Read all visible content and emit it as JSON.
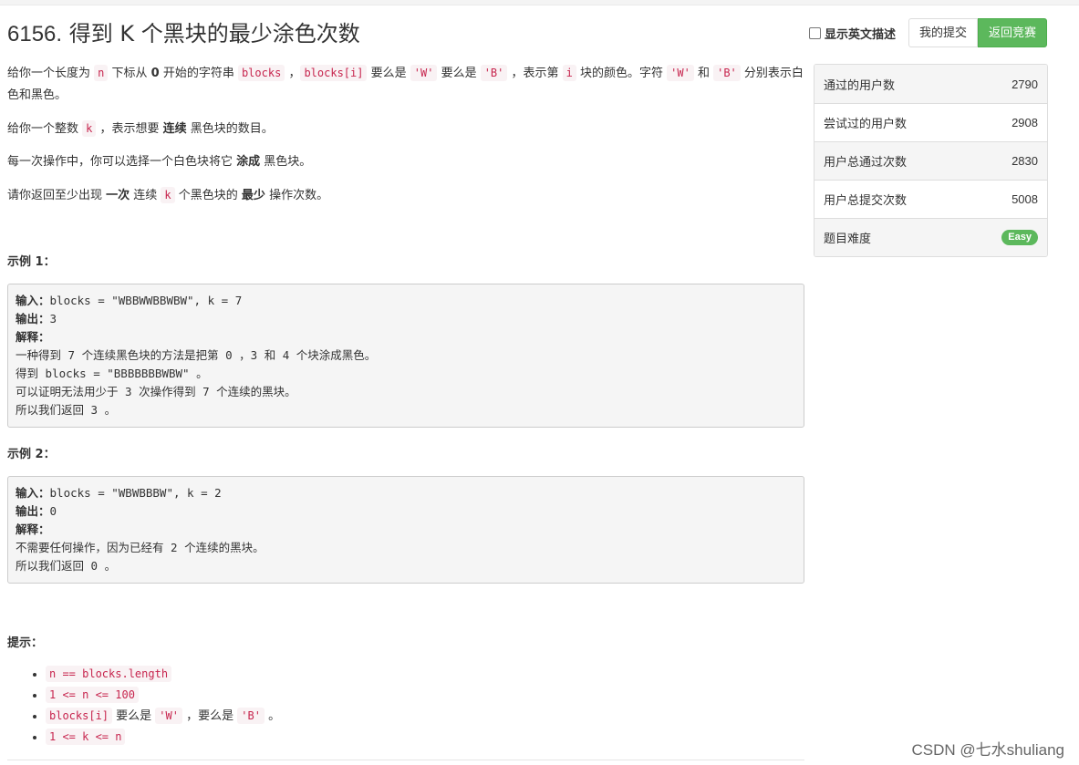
{
  "problem": {
    "number": "6156.",
    "title_text": "得到 K 个黑块的最少涂色次数"
  },
  "toolbar": {
    "english_toggle_label": "显示英文描述",
    "my_submissions_label": "我的提交",
    "back_to_contest_label": "返回竞赛"
  },
  "description": {
    "p1": {
      "t1": "给你一个长度为 ",
      "c1": "n",
      "t2": " 下标从 ",
      "b1": "0",
      "t3": " 开始的字符串 ",
      "c2": "blocks",
      "t4": " ，",
      "c3": "blocks[i]",
      "t5": " 要么是 ",
      "c4": "'W'",
      "t6": " 要么是 ",
      "c5": "'B'",
      "t7": " ，表示第 ",
      "c6": "i",
      "t8": " 块的颜色。字符 ",
      "c7": "'W'",
      "t9": " 和 ",
      "c8": "'B'",
      "t10": " 分别表示白色和黑色。"
    },
    "p2": {
      "t1": "给你一个整数 ",
      "c1": "k",
      "t2": " ，表示想要 ",
      "b1": "连续",
      "t3": " 黑色块的数目。"
    },
    "p3": {
      "t1": "每一次操作中，你可以选择一个白色块将它 ",
      "b1": "涂成",
      "t2": " 黑色块。"
    },
    "p4": {
      "t1": "请你返回至少出现 ",
      "b1": "一次",
      "t2": " 连续 ",
      "c1": "k",
      "t3": " 个黑色块的 ",
      "b2": "最少",
      "t4": " 操作次数。"
    }
  },
  "example1": {
    "heading": "示例 1：",
    "input_label": "输入：",
    "input_value": "blocks = \"WBBWWBBWBW\", k = 7",
    "output_label": "输出：",
    "output_value": "3",
    "explain_label": "解释：",
    "lines": [
      "一种得到 7 个连续黑色块的方法是把第 0 ，3 和 4 个块涂成黑色。",
      "得到 blocks = \"BBBBBBBWBW\" 。",
      "可以证明无法用少于 3 次操作得到 7 个连续的黑块。",
      "所以我们返回 3 。"
    ]
  },
  "example2": {
    "heading": "示例 2：",
    "input_label": "输入：",
    "input_value": "blocks = \"WBWBBBW\", k = 2",
    "output_label": "输出：",
    "output_value": "0",
    "explain_label": "解释：",
    "lines": [
      "不需要任何操作，因为已经有 2 个连续的黑块。",
      "所以我们返回 0 。"
    ]
  },
  "hints": {
    "heading": "提示：",
    "h1": "n == blocks.length",
    "h2": "1 <= n <= 100",
    "h3": {
      "c1": "blocks[i]",
      "t1": " 要么是 ",
      "c2": "'W'",
      "t2": " ，要么是 ",
      "c3": "'B'",
      "t3": " 。"
    },
    "h4": "1 <= k <= n"
  },
  "stats": {
    "passed_users_label": "通过的用户数",
    "passed_users": "2790",
    "tried_users_label": "尝试过的用户数",
    "tried_users": "2908",
    "total_accepted_label": "用户总通过次数",
    "total_accepted": "2830",
    "total_submissions_label": "用户总提交次数",
    "total_submissions": "5008",
    "difficulty_label": "题目难度",
    "difficulty": "Easy"
  },
  "watermark": "CSDN @七水shuliang",
  "colors": {
    "accent_green": "#5cb85c",
    "code_red": "#c7254e",
    "code_bg": "#f9f2f4"
  }
}
